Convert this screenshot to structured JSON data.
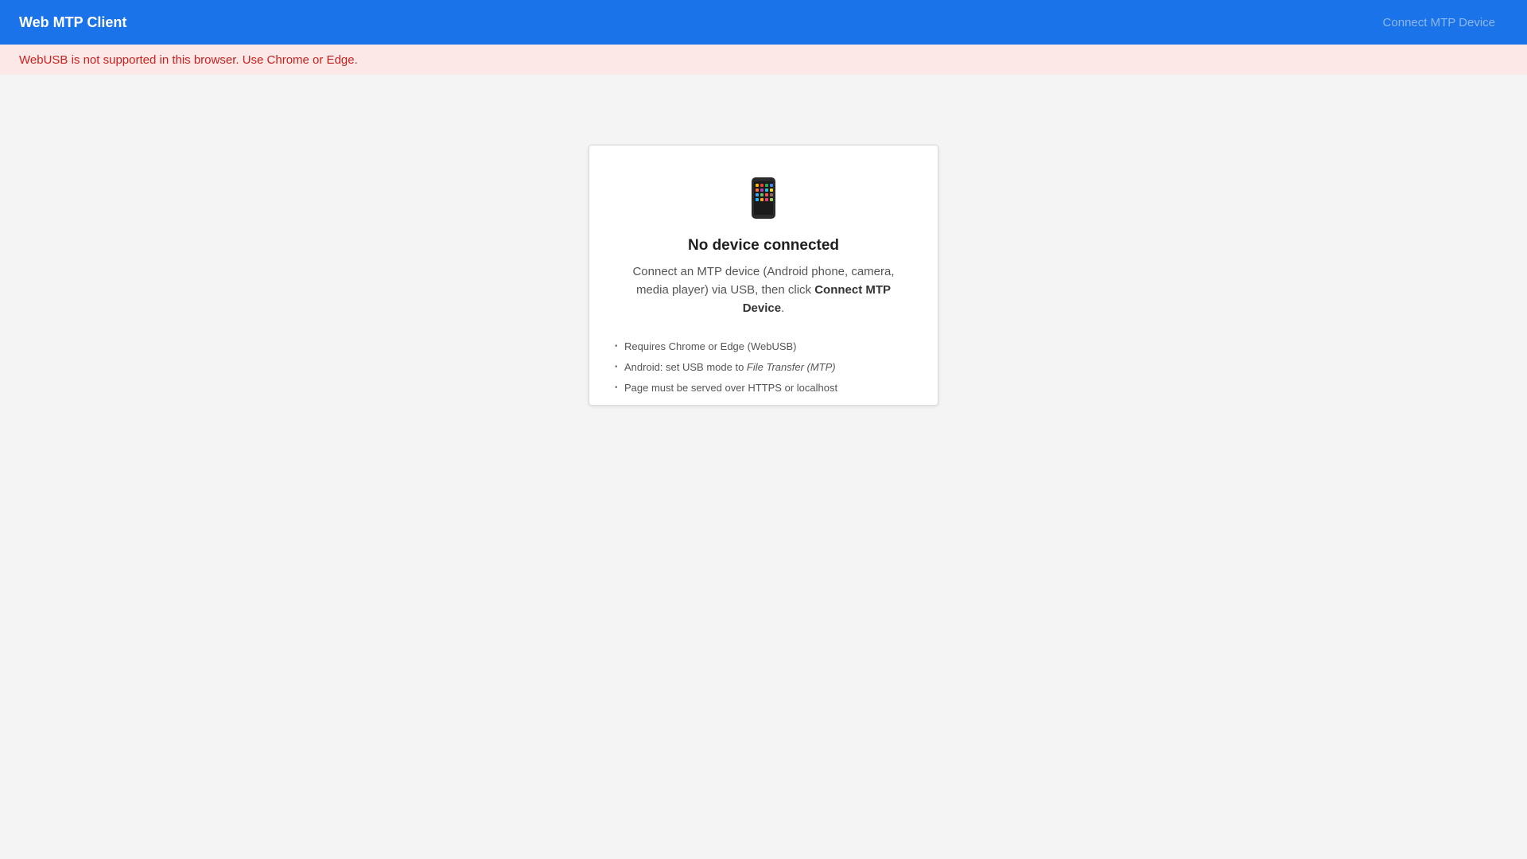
{
  "header": {
    "title": "Web MTP Client",
    "connect_label": "Connect MTP Device"
  },
  "banner": {
    "message": "WebUSB is not supported in this browser. Use Chrome or Edge."
  },
  "empty_state": {
    "icon": "mobile-phone-icon",
    "heading": "No device connected",
    "description_prefix": "Connect an MTP device (Android phone, camera, media player) via USB, then click ",
    "description_action": "Connect MTP Device",
    "description_suffix": ".",
    "requirements": [
      {
        "text": "Requires Chrome or Edge (WebUSB)"
      },
      {
        "prefix": "Android: set USB mode to ",
        "emphasis": "File Transfer (MTP)"
      },
      {
        "text": "Page must be served over HTTPS or localhost"
      }
    ]
  },
  "colors": {
    "header_bg": "#1a73e8",
    "banner_bg": "#fce8e6",
    "banner_text": "#c5221f",
    "page_bg": "#f4f4f4"
  }
}
